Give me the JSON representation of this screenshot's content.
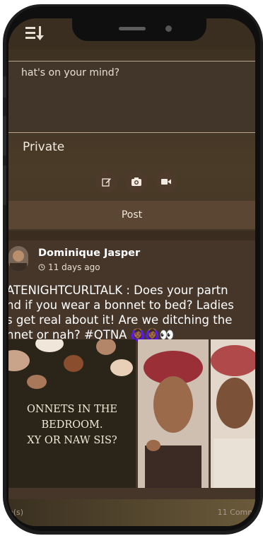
{
  "composer": {
    "placeholder": "hat's on your mind?"
  },
  "privacy": {
    "label": "Private"
  },
  "post_button": {
    "label": "Post"
  },
  "post": {
    "author": "Dominique Jasper",
    "time": "11 days ago",
    "text_lines": [
      "ATENIGHTCURLTALK : Does your partn",
      "nd if you wear a bonnet to bed? Ladies",
      "s get real about it! Are we ditching the",
      "nnet or nah? #QTNA"
    ],
    "emoji": "🙆🏾‍♀️🙆🏾‍♀️👀",
    "media_text_lines": [
      "ONNETS IN THE",
      "BEDROOM.",
      "XY OR NAW SIS?"
    ],
    "likes": "e(s)",
    "comments": "11 Comm"
  },
  "icons": {
    "menu": "menu-sort-icon",
    "edit": "edit-icon",
    "camera": "camera-icon",
    "video": "video-icon",
    "clock": "clock-icon"
  }
}
